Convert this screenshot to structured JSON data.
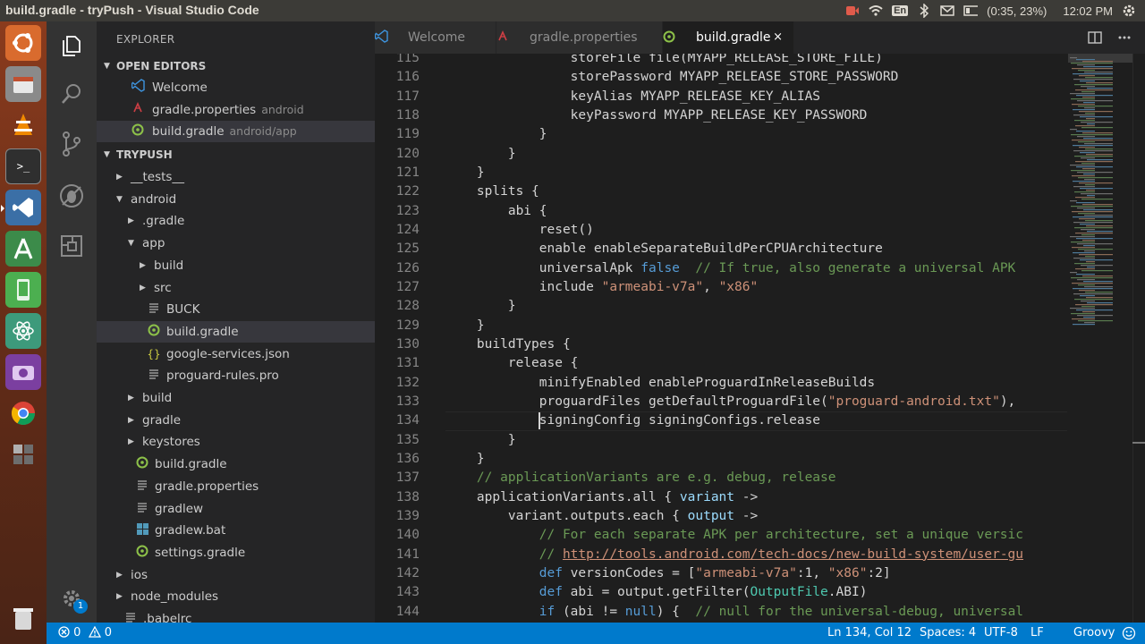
{
  "window": {
    "title": "build.gradle - tryPush - Visual Studio Code"
  },
  "system_tray": {
    "keyboard": "En",
    "battery": "(0:35, 23%)",
    "time": "12:02 PM"
  },
  "launcher": {
    "apps": [
      "ubuntu-logo",
      "files",
      "vlc",
      "terminal",
      "vscode",
      "android-studio",
      "phone-app",
      "atom",
      "screenshot",
      "chrome",
      "workspace-switcher",
      "trash"
    ]
  },
  "activity_bar": {
    "items": [
      "explorer-icon",
      "search-icon",
      "source-control-icon",
      "debug-icon",
      "extensions-icon"
    ],
    "settings_badge": "1"
  },
  "explorer": {
    "title": "EXPLORER",
    "open_editors": {
      "header": "OPEN EDITORS",
      "items": [
        {
          "name": "Welcome",
          "desc": "",
          "icon": "vscode-icon"
        },
        {
          "name": "gradle.properties",
          "desc": "android",
          "icon": "gradle-properties-icon"
        },
        {
          "name": "build.gradle",
          "desc": "android/app",
          "icon": "gradle-icon"
        }
      ]
    },
    "project": {
      "header": "TRYPUSH",
      "items": [
        {
          "name": "__tests__",
          "type": "folder"
        },
        {
          "name": "android",
          "type": "folder-open"
        },
        {
          "name": ".gradle",
          "type": "folder"
        },
        {
          "name": "app",
          "type": "folder-open"
        },
        {
          "name": "build",
          "type": "folder"
        },
        {
          "name": "src",
          "type": "folder"
        },
        {
          "name": "BUCK",
          "type": "file"
        },
        {
          "name": "build.gradle",
          "type": "gradle"
        },
        {
          "name": "google-services.json",
          "type": "json"
        },
        {
          "name": "proguard-rules.pro",
          "type": "file"
        },
        {
          "name": "build",
          "type": "folder"
        },
        {
          "name": "gradle",
          "type": "folder"
        },
        {
          "name": "keystores",
          "type": "folder"
        },
        {
          "name": "build.gradle",
          "type": "gradle"
        },
        {
          "name": "gradle.properties",
          "type": "file"
        },
        {
          "name": "gradlew",
          "type": "file"
        },
        {
          "name": "gradlew.bat",
          "type": "windows"
        },
        {
          "name": "settings.gradle",
          "type": "gradle"
        },
        {
          "name": "ios",
          "type": "folder"
        },
        {
          "name": "node_modules",
          "type": "folder"
        },
        {
          "name": ".babelrc",
          "type": "file"
        }
      ]
    }
  },
  "tabs": [
    {
      "label": "Welcome",
      "icon": "vscode-icon"
    },
    {
      "label": "gradle.properties",
      "icon": "gradle-properties-icon"
    },
    {
      "label": "build.gradle",
      "icon": "gradle-icon",
      "close": "×"
    }
  ],
  "editor": {
    "cursor_line": 134,
    "lines": [
      {
        "n": "115",
        "t": [
          [
            "p",
            "                storeFile file(MYAPP_RELEASE_STORE_FILE)"
          ]
        ]
      },
      {
        "n": "116",
        "t": [
          [
            "p",
            "                storePassword MYAPP_RELEASE_STORE_PASSWORD"
          ]
        ]
      },
      {
        "n": "117",
        "t": [
          [
            "p",
            "                keyAlias MYAPP_RELEASE_KEY_ALIAS"
          ]
        ]
      },
      {
        "n": "118",
        "t": [
          [
            "p",
            "                keyPassword MYAPP_RELEASE_KEY_PASSWORD"
          ]
        ]
      },
      {
        "n": "119",
        "t": [
          [
            "p",
            "            }"
          ]
        ]
      },
      {
        "n": "120",
        "t": [
          [
            "p",
            "        }"
          ]
        ]
      },
      {
        "n": "121",
        "t": [
          [
            "p",
            "    }"
          ]
        ]
      },
      {
        "n": "122",
        "t": [
          [
            "p",
            "    splits {"
          ]
        ]
      },
      {
        "n": "123",
        "t": [
          [
            "p",
            "        abi {"
          ]
        ]
      },
      {
        "n": "124",
        "t": [
          [
            "p",
            "            reset()"
          ]
        ]
      },
      {
        "n": "125",
        "t": [
          [
            "p",
            "            enable enableSeparateBuildPerCPUArchitecture"
          ]
        ]
      },
      {
        "n": "126",
        "t": [
          [
            "p",
            "            universalApk "
          ],
          [
            "k",
            "false"
          ],
          [
            "c",
            "  // If true, also generate a universal APK"
          ]
        ]
      },
      {
        "n": "127",
        "t": [
          [
            "p",
            "            include "
          ],
          [
            "s",
            "\"armeabi-v7a\""
          ],
          [
            "p",
            ", "
          ],
          [
            "s",
            "\"x86\""
          ]
        ]
      },
      {
        "n": "128",
        "t": [
          [
            "p",
            "        }"
          ]
        ]
      },
      {
        "n": "129",
        "t": [
          [
            "p",
            "    }"
          ]
        ]
      },
      {
        "n": "130",
        "t": [
          [
            "p",
            "    buildTypes {"
          ]
        ]
      },
      {
        "n": "131",
        "t": [
          [
            "p",
            "        release {"
          ]
        ]
      },
      {
        "n": "132",
        "t": [
          [
            "p",
            "            minifyEnabled enableProguardInReleaseBuilds"
          ]
        ]
      },
      {
        "n": "133",
        "t": [
          [
            "p",
            "            proguardFiles getDefaultProguardFile("
          ],
          [
            "s",
            "\"proguard-android.txt\""
          ],
          [
            "p",
            "),"
          ]
        ]
      },
      {
        "n": "134",
        "t": [
          [
            "p",
            "            signingConfig signingConfigs.release"
          ]
        ]
      },
      {
        "n": "135",
        "t": [
          [
            "p",
            "        }"
          ]
        ]
      },
      {
        "n": "136",
        "t": [
          [
            "p",
            "    }"
          ]
        ]
      },
      {
        "n": "137",
        "t": [
          [
            "c",
            "    // applicationVariants are e.g. debug, release"
          ]
        ]
      },
      {
        "n": "138",
        "t": [
          [
            "p",
            "    applicationVariants.all { "
          ],
          [
            "v",
            "variant"
          ],
          [
            "p",
            " ->"
          ]
        ]
      },
      {
        "n": "139",
        "t": [
          [
            "p",
            "        variant.outputs.each { "
          ],
          [
            "v",
            "output"
          ],
          [
            "p",
            " ->"
          ]
        ]
      },
      {
        "n": "140",
        "t": [
          [
            "c",
            "            // For each separate APK per architecture, set a unique versic"
          ]
        ]
      },
      {
        "n": "141",
        "t": [
          [
            "c",
            "            // "
          ],
          [
            "u",
            "http://tools.android.com/tech-docs/new-build-system/user-gu"
          ]
        ]
      },
      {
        "n": "142",
        "t": [
          [
            "k",
            "            def"
          ],
          [
            "p",
            " versionCodes = ["
          ],
          [
            "s",
            "\"armeabi-v7a\""
          ],
          [
            "p",
            ":1, "
          ],
          [
            "s",
            "\"x86\""
          ],
          [
            "p",
            ":2]"
          ]
        ]
      },
      {
        "n": "143",
        "t": [
          [
            "k",
            "            def"
          ],
          [
            "p",
            " abi = output.getFilter("
          ],
          [
            "t",
            "OutputFile"
          ],
          [
            "p",
            ".ABI)"
          ]
        ]
      },
      {
        "n": "144",
        "t": [
          [
            "k",
            "            if"
          ],
          [
            "p",
            " (abi != "
          ],
          [
            "k",
            "null"
          ],
          [
            "p",
            ") {  "
          ],
          [
            "c",
            "// null for the universal-debug, universal"
          ]
        ]
      }
    ]
  },
  "status_bar": {
    "errors": "0",
    "warnings": "0",
    "position": "Ln 134, Col 12",
    "indent": "Spaces: 4",
    "encoding": "UTF-8",
    "eol": "LF",
    "language": "Groovy"
  },
  "colors": {
    "accent": "#007acc",
    "launcher": "#8a3b1d",
    "topbar": "#3c3b37"
  }
}
